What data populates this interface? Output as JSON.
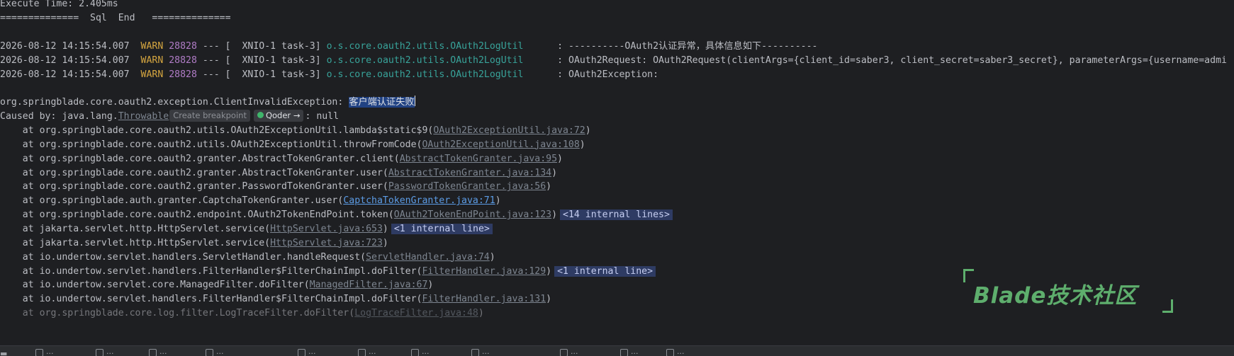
{
  "console": {
    "execute_time": "Execute Time: 2.405ms",
    "sql_end": "==============  Sql  End   ==============",
    "log_lines": [
      {
        "timestamp": "2026-08-12 14:15:54.007",
        "level": "WARN",
        "pid": "28828",
        "sep": "--- [",
        "thread": "XNIO-1 task-3]",
        "logger": "o.s.core.oauth2.utils.OAuth2LogUtil",
        "message": ": ----------OAuth2认证异常，具体信息如下----------"
      },
      {
        "timestamp": "2026-08-12 14:15:54.007",
        "level": "WARN",
        "pid": "28828",
        "sep": "--- [",
        "thread": "XNIO-1 task-3]",
        "logger": "o.s.core.oauth2.utils.OAuth2LogUtil",
        "message": ": OAuth2Request: OAuth2Request(clientArgs={client_id=saber3, client_secret=saber3_secret}, parameterArgs={username=admi"
      },
      {
        "timestamp": "2026-08-12 14:15:54.007",
        "level": "WARN",
        "pid": "28828",
        "sep": "--- [",
        "thread": "XNIO-1 task-3]",
        "logger": "o.s.core.oauth2.utils.OAuth2LogUtil",
        "message": ": OAuth2Exception:"
      }
    ],
    "exception_class": "org.springblade.core.oauth2.exception.ClientInvalidException: ",
    "exception_message": "客户端认证失败",
    "caused_by_prefix": "Caused by: java.lang.",
    "caused_by_class": "Throwable",
    "create_breakpoint": "Create breakpoint",
    "qoder_label": "Qoder →",
    "caused_by_suffix": ": null",
    "stack": [
      {
        "text": "    at org.springblade.core.oauth2.utils.OAuth2ExceptionUtil.lambda$static$9(",
        "link": "OAuth2ExceptionUtil.java:72",
        "close": ")",
        "fold": ""
      },
      {
        "text": "    at org.springblade.core.oauth2.utils.OAuth2ExceptionUtil.throwFromCode(",
        "link": "OAuth2ExceptionUtil.java:108",
        "close": ")",
        "fold": ""
      },
      {
        "text": "    at org.springblade.core.oauth2.granter.AbstractTokenGranter.client(",
        "link": "AbstractTokenGranter.java:95",
        "close": ")",
        "fold": ""
      },
      {
        "text": "    at org.springblade.core.oauth2.granter.AbstractTokenGranter.user(",
        "link": "AbstractTokenGranter.java:134",
        "close": ")",
        "fold": ""
      },
      {
        "text": "    at org.springblade.core.oauth2.granter.PasswordTokenGranter.user(",
        "link": "PasswordTokenGranter.java:56",
        "close": ")",
        "fold": ""
      },
      {
        "text": "    at org.springblade.auth.granter.CaptchaTokenGranter.user(",
        "link": "CaptchaTokenGranter.java:71",
        "close": ")",
        "fold": "",
        "blue": true
      },
      {
        "text": "    at org.springblade.core.oauth2.endpoint.OAuth2TokenEndPoint.token(",
        "link": "OAuth2TokenEndPoint.java:123",
        "close": ")",
        "fold": "<14 internal lines>"
      },
      {
        "text": "    at jakarta.servlet.http.HttpServlet.service(",
        "link": "HttpServlet.java:653",
        "close": ")",
        "fold": "<1 internal line>"
      },
      {
        "text": "    at jakarta.servlet.http.HttpServlet.service(",
        "link": "HttpServlet.java:723",
        "close": ")",
        "fold": ""
      },
      {
        "text": "    at io.undertow.servlet.handlers.ServletHandler.handleRequest(",
        "link": "ServletHandler.java:74",
        "close": ")",
        "fold": ""
      },
      {
        "text": "    at io.undertow.servlet.handlers.FilterHandler$FilterChainImpl.doFilter(",
        "link": "FilterHandler.java:129",
        "close": ")",
        "fold": "<1 internal line>"
      },
      {
        "text": "    at io.undertow.servlet.core.ManagedFilter.doFilter(",
        "link": "ManagedFilter.java:67",
        "close": ")",
        "fold": ""
      },
      {
        "text": "    at io.undertow.servlet.handlers.FilterHandler$FilterChainImpl.doFilter(",
        "link": "FilterHandler.java:131",
        "close": ")",
        "fold": ""
      },
      {
        "text": "    at org.springblade.core.log.filter.LogTraceFilter.doFilter(",
        "link": "LogTraceFilter.java:48",
        "close": ")",
        "fold": ""
      }
    ]
  },
  "watermark": {
    "text": "Blade技术社区"
  },
  "colors": {
    "background": "#1e1f22",
    "warn": "#d5a640",
    "pid": "#b07cc6",
    "logger": "#38a39a",
    "selection": "#214283",
    "watermark": "#5eae6d"
  }
}
